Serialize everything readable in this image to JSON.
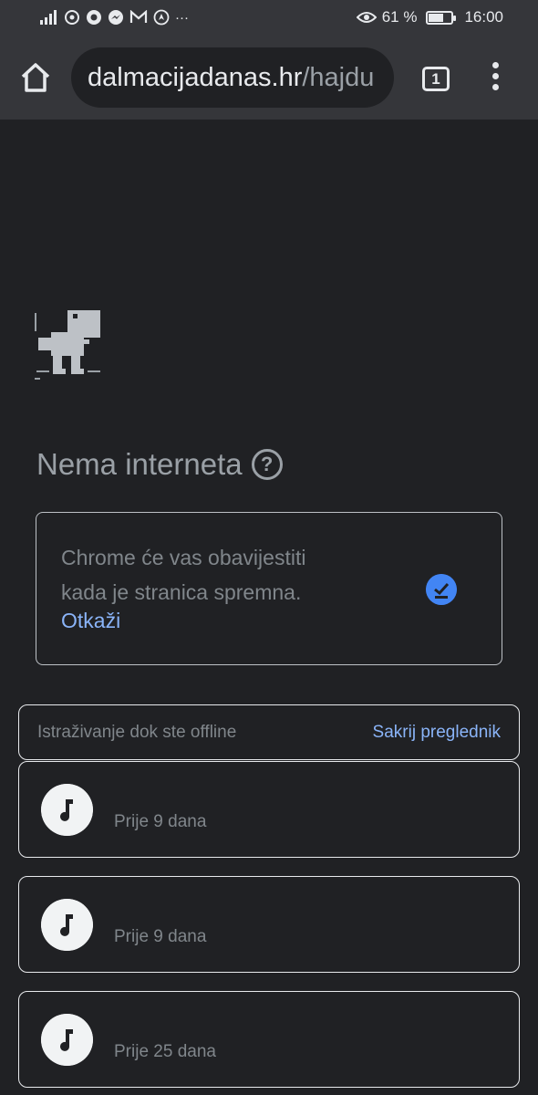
{
  "status_bar": {
    "battery_percent": "61 %",
    "battery_level": 0.61,
    "time": "16:00",
    "more_indicator": "···"
  },
  "toolbar": {
    "url_domain": "dalmacijadanas.hr",
    "url_path": "/hajdu",
    "tab_count": "1"
  },
  "offline": {
    "title": "Nema interneta",
    "notify_line1": "Chrome će vas obavijestiti",
    "notify_line2": "kada je stranica spremna.",
    "cancel_label": "Otkaži"
  },
  "explore": {
    "title": "Istraživanje dok ste offline",
    "hide_label": "Sakrij preglednik",
    "articles": [
      {
        "icon": "music-note-icon",
        "date": "Prije 9 dana"
      },
      {
        "icon": "music-note-icon",
        "date": "Prije 9 dana"
      },
      {
        "icon": "music-note-icon",
        "date": "Prije 25 dana"
      }
    ]
  },
  "colors": {
    "background": "#202124",
    "toolbar": "#35363a",
    "accent": "#8ab4f8",
    "check_blue": "#4285f4"
  }
}
